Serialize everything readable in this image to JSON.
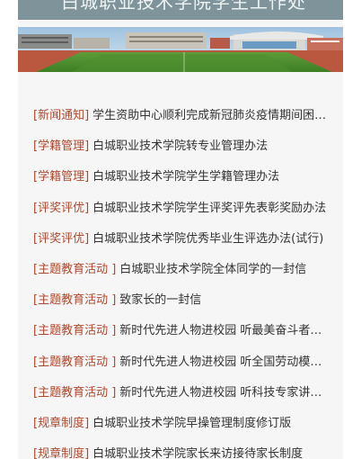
{
  "header": {
    "title": "白城职业技术学院学生工作处"
  },
  "colors": {
    "category": "#b0482e",
    "title": "#333333",
    "panel_bg": "#f6f6f6",
    "topbar": "#7f949a"
  },
  "news": [
    {
      "category": "[新闻通知]",
      "title": "学生资助中心顺利完成新冠肺炎疫情期间困难学生补助发放工作"
    },
    {
      "category": "[学籍管理]",
      "title": "白城职业技术学院转专业管理办法"
    },
    {
      "category": "[学籍管理]",
      "title": "白城职业技术学院学生学籍管理办法"
    },
    {
      "category": "[评奖评优]",
      "title": "白城职业技术学院学生评奖评先表彰奖励办法"
    },
    {
      "category": "[评奖评优]",
      "title": "白城职业技术学院优秀毕业生评选办法(试行)"
    },
    {
      "category": "[主题教育活动 ]",
      "title": "白城职业技术学院全体同学的一封信"
    },
    {
      "category": "[主题教育活动 ]",
      "title": "致家长的一封信"
    },
    {
      "category": "[主题教育活动 ]",
      "title": "新时代先进人物进校园 听最美奋斗者讲述奋斗故事"
    },
    {
      "category": "[主题教育活动 ]",
      "title": "新时代先进人物进校园 听全国劳动模范讲述劳动故事"
    },
    {
      "category": "[主题教育活动 ]",
      "title": "新时代先进人物进校园 听科技专家讲述科研故事"
    },
    {
      "category": "[规章制度]",
      "title": "白城职业技术学院早操管理制度修订版"
    },
    {
      "category": "[规章制度]",
      "title": "白城职业技术学院家长来访接待家长制度"
    }
  ]
}
